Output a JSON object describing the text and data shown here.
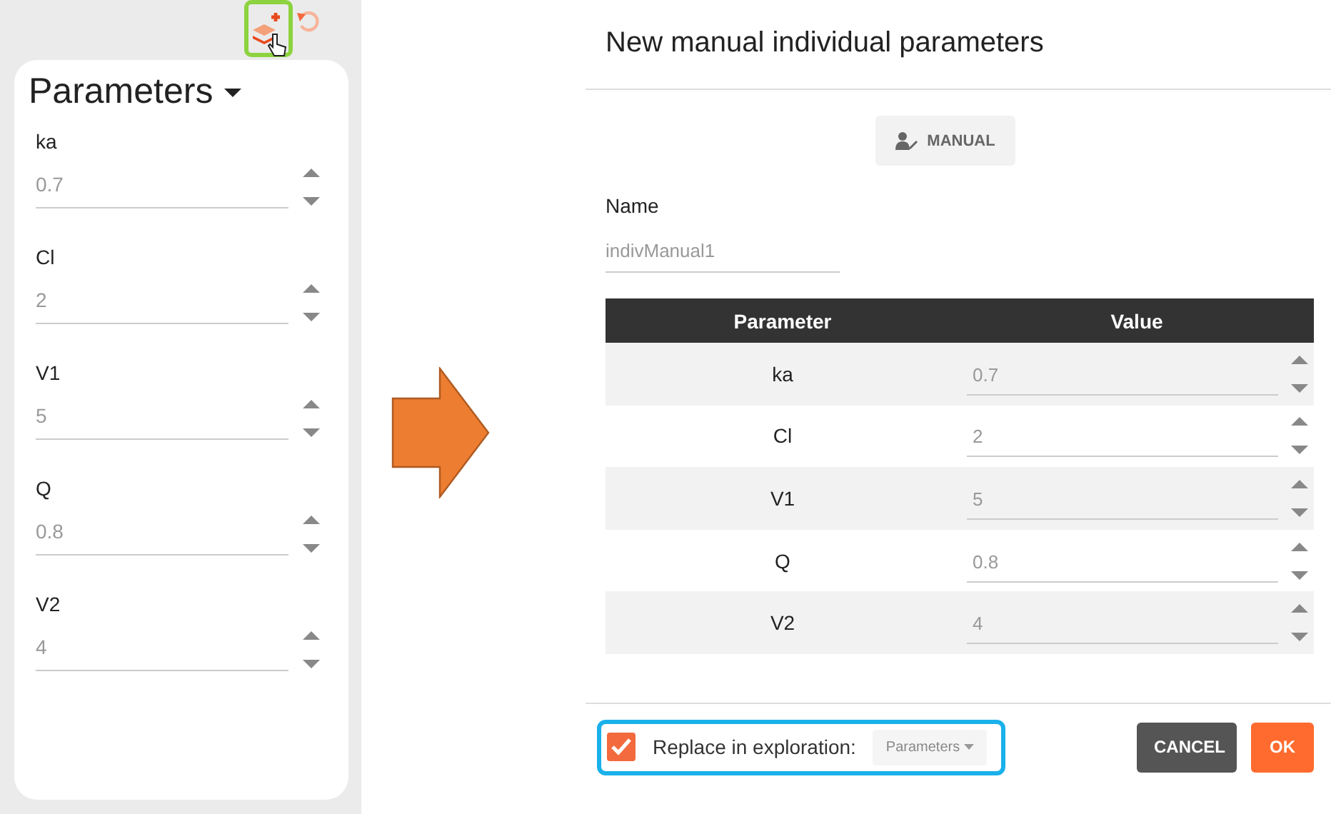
{
  "toolbar": {
    "add_highlighted": true
  },
  "parameters_panel": {
    "title": "Parameters",
    "fields": [
      {
        "label": "ka",
        "value": "0.7"
      },
      {
        "label": "Cl",
        "value": "2"
      },
      {
        "label": "V1",
        "value": "5"
      },
      {
        "label": "Q",
        "value": "0.8"
      },
      {
        "label": "V2",
        "value": "4"
      }
    ]
  },
  "dialog": {
    "title": "New manual individual parameters",
    "mode_button": "MANUAL",
    "name": {
      "label": "Name",
      "value": "indivManual1"
    },
    "table": {
      "columns": [
        "Parameter",
        "Value"
      ],
      "rows": [
        {
          "parameter": "ka",
          "value": "0.7"
        },
        {
          "parameter": "Cl",
          "value": "2"
        },
        {
          "parameter": "V1",
          "value": "5"
        },
        {
          "parameter": "Q",
          "value": "0.8"
        },
        {
          "parameter": "V2",
          "value": "4"
        }
      ]
    },
    "replace": {
      "checked": true,
      "highlighted": true,
      "label": "Replace in exploration:",
      "dropdown": "Parameters"
    },
    "buttons": [
      {
        "label": "CANCEL",
        "kind": "secondary"
      },
      {
        "label": "OK",
        "kind": "primary"
      }
    ]
  }
}
